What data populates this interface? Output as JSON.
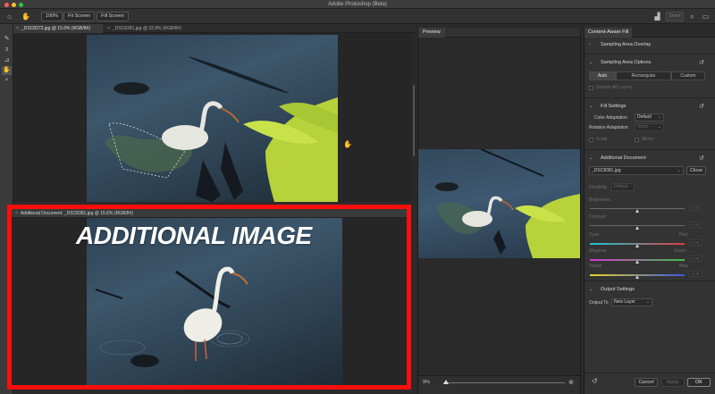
{
  "app": {
    "title": "Adobe Photoshop (Beta)"
  },
  "options_bar": {
    "zoom_label": "100%",
    "fit_screen_label": "Fit Screen",
    "fill_screen_label": "Fill Screen",
    "share_label": "Share"
  },
  "doc_tabs": [
    {
      "label": "_DSC8372.jpg @ 15.6% (RGB/8#)",
      "active": true
    },
    {
      "label": "_DSC8381.jpg @ 32.8% (RGB/8#)",
      "active": false
    }
  ],
  "additional_document": {
    "tab_label": "Additional Document: _DSC8381.jpg @ 15.6% (RGB/8#)",
    "overlay_text": "ADDITIONAL IMAGE"
  },
  "preview": {
    "tab_label": "Preview",
    "zoom_value": "9%",
    "zoom_fraction": 0.02
  },
  "panel": {
    "tab_label": "Content-Aware Fill",
    "sampling_overlay": {
      "title": "Sampling Area Overlay"
    },
    "sampling_options": {
      "title": "Sampling Area Options",
      "modes": [
        "Auto",
        "Rectangular",
        "Custom"
      ],
      "selected_mode": "Auto",
      "sample_all_layers": "Sample All Layers"
    },
    "fill_settings": {
      "title": "Fill Settings",
      "color_adaptation_label": "Color Adaptation",
      "color_adaptation_value": "Default",
      "rotation_adaptation_label": "Rotation Adaptation",
      "rotation_adaptation_value": "None",
      "scale_label": "Scale",
      "mirror_label": "Mirror"
    },
    "additional_document": {
      "title": "Additional Document",
      "file_value": "_DSC8381.jpg",
      "close_label": "Close",
      "flexibility_label": "Flexibility",
      "flexibility_value": "Default",
      "sliders": [
        {
          "label": "Brightness",
          "left": "",
          "right": "",
          "value": "0.00",
          "level": 0.5,
          "color": "#6a6a6a"
        },
        {
          "label": "Contrast",
          "left": "",
          "right": "",
          "value": "0.00",
          "level": 0.5,
          "color": "#6a6a6a"
        },
        {
          "label": "",
          "left": "Cyan",
          "right": "Red",
          "value": "0.00",
          "level": 0.5,
          "color": "cyan-red"
        },
        {
          "label": "",
          "left": "Magenta",
          "right": "Green",
          "value": "0.00",
          "level": 0.5,
          "color": "magenta-green"
        },
        {
          "label": "",
          "left": "Yellow",
          "right": "Blue",
          "value": "0.00",
          "level": 0.5,
          "color": "yellow-blue"
        }
      ]
    },
    "output_settings": {
      "title": "Output Settings",
      "output_to_label": "Output To",
      "output_to_value": "New Layer"
    },
    "footer": {
      "cancel_label": "Cancel",
      "apply_label": "Apply",
      "ok_label": "OK"
    }
  },
  "colors": {
    "highlight_border": "#ff0d0d",
    "fern": "#c7e03a"
  }
}
